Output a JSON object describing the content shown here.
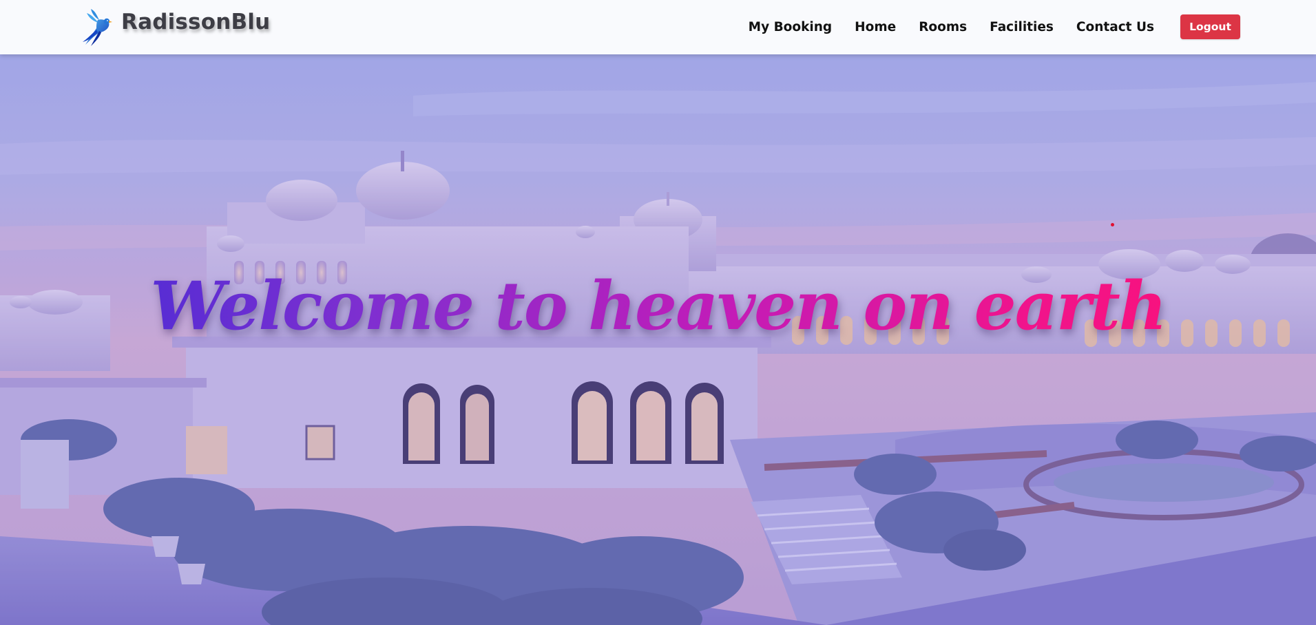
{
  "navbar": {
    "brand": {
      "name": "RadissonBlu",
      "logo_icon": "bird-icon"
    },
    "links": [
      {
        "label": "My Booking"
      },
      {
        "label": "Home"
      },
      {
        "label": "Rooms"
      },
      {
        "label": "Facilities"
      },
      {
        "label": "Contact Us"
      }
    ],
    "logout_label": "Logout"
  },
  "hero": {
    "title": "Welcome to heaven on earth",
    "background": "palace-at-dusk-image"
  },
  "colors": {
    "logout": "#dc3545",
    "title_gradient_start": "#3c2bd6",
    "title_gradient_end": "#ff1070",
    "brand_text": "#3d3d45"
  }
}
